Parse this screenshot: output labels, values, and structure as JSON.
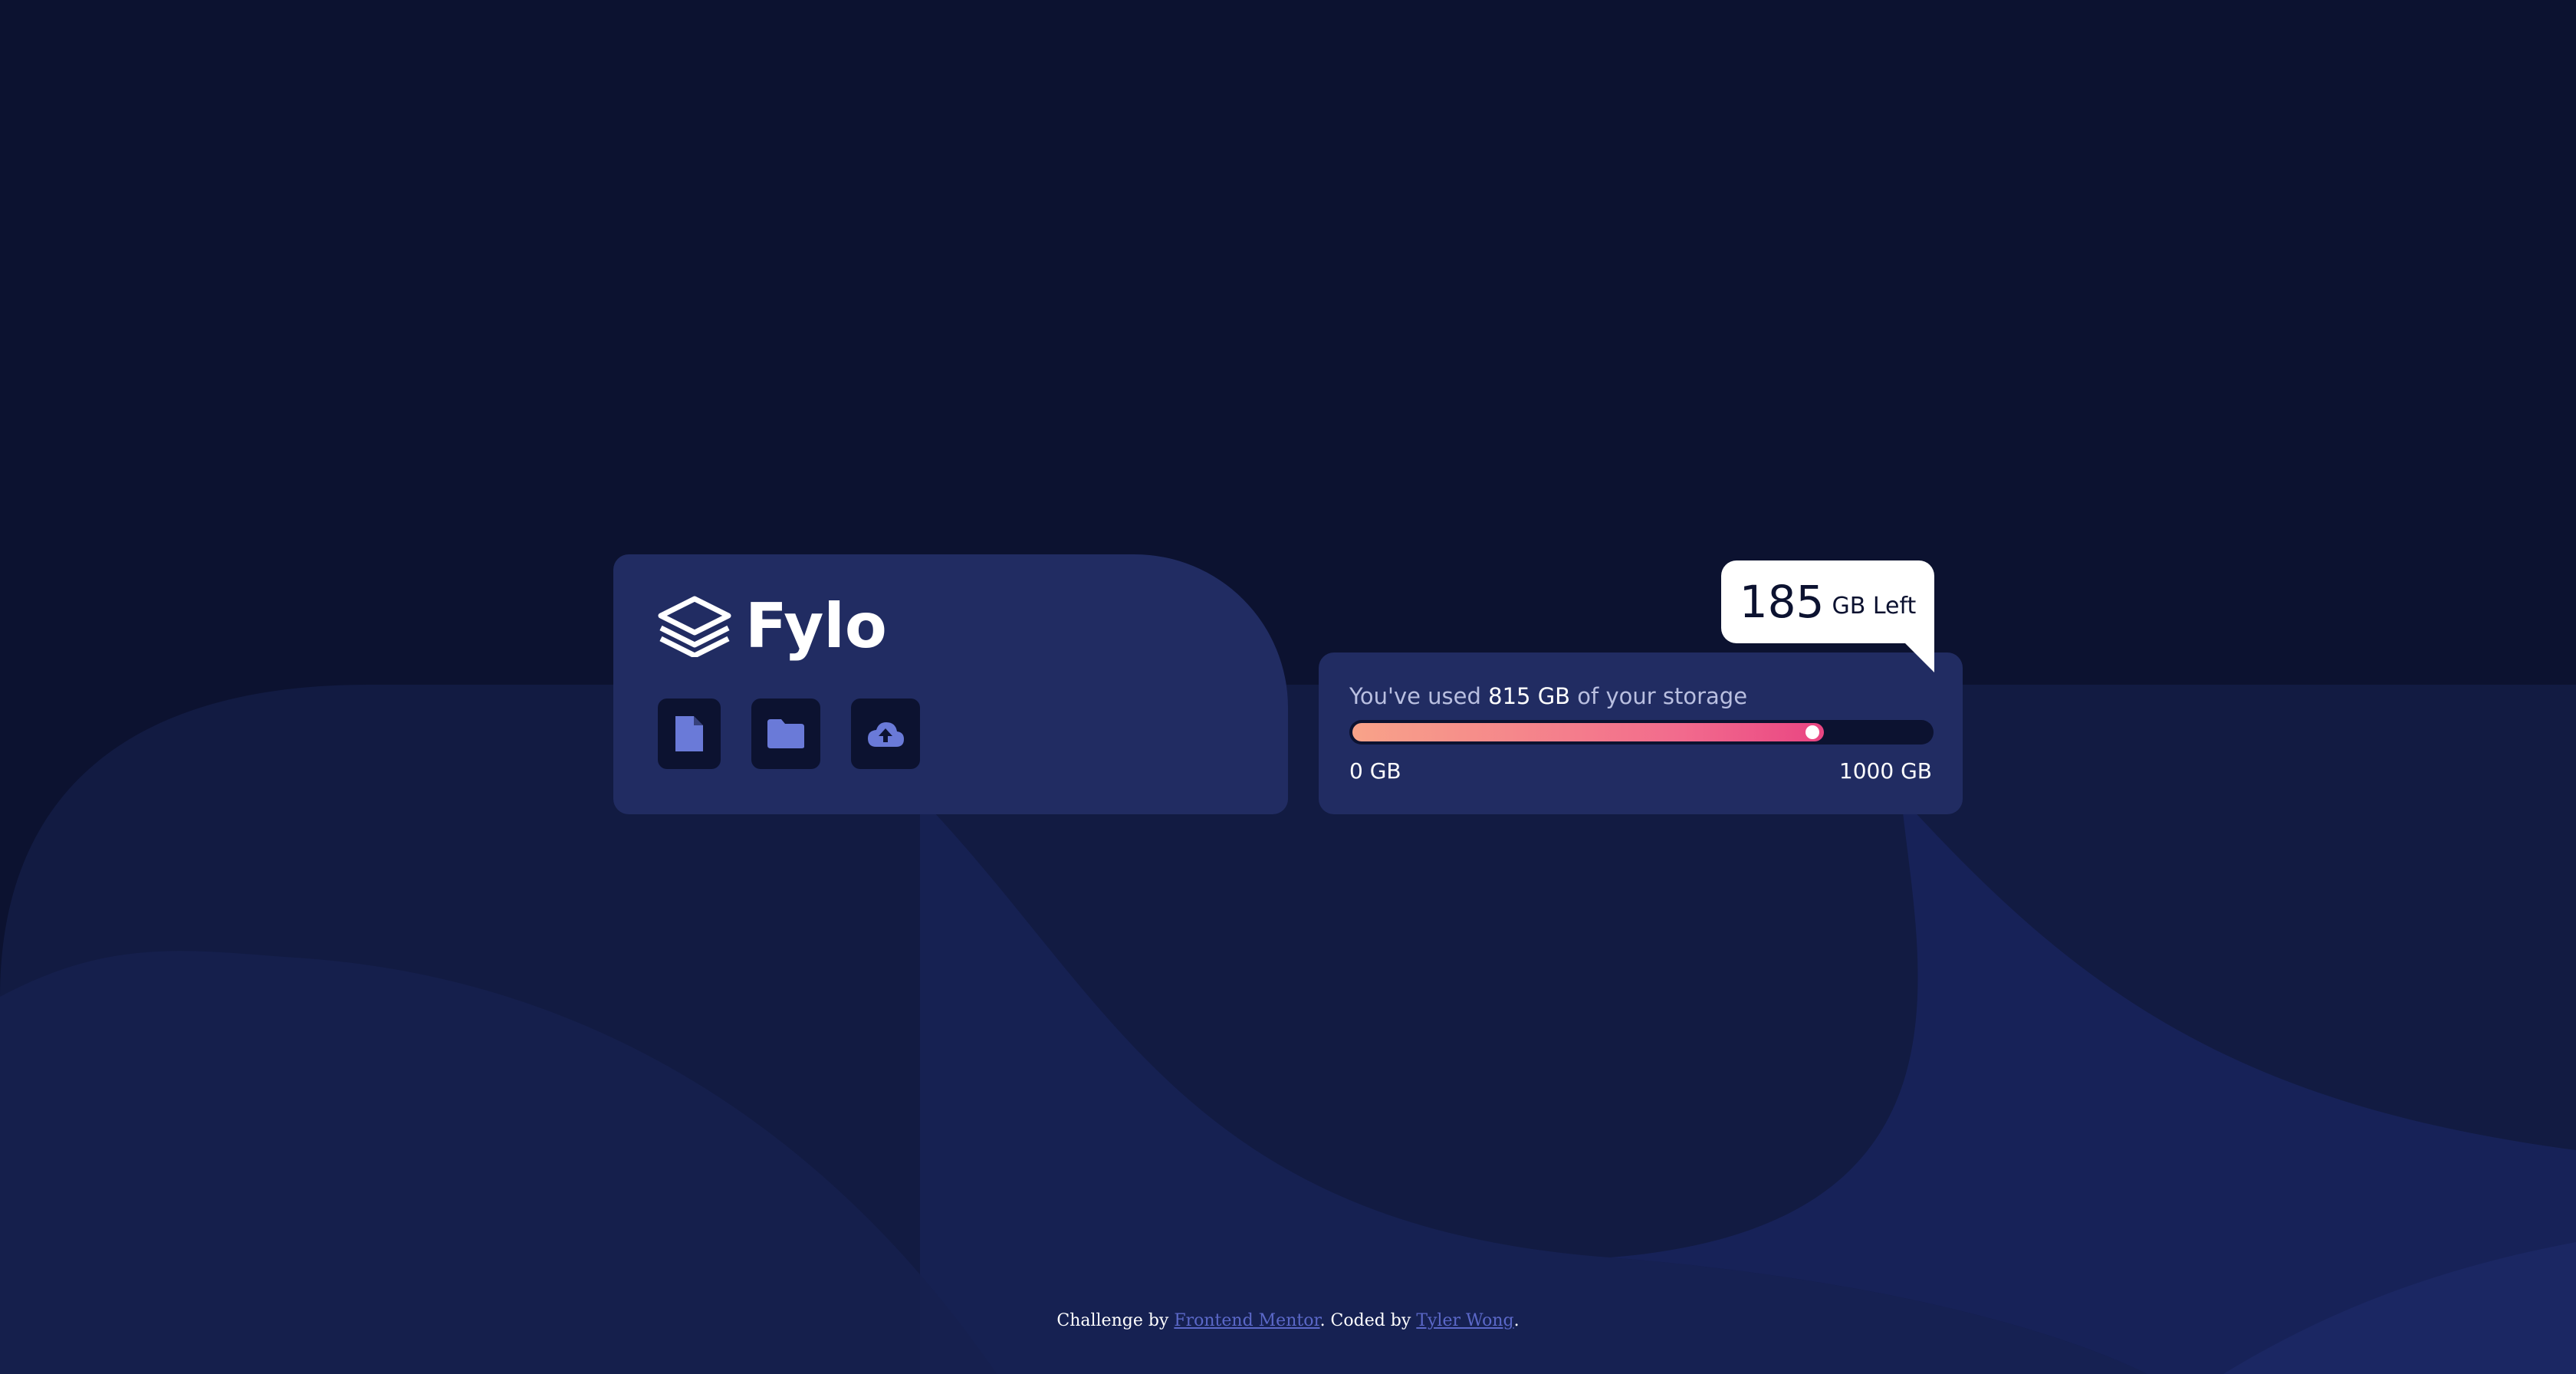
{
  "brand": {
    "name": "Fylo",
    "logo_icon": "layers-icon"
  },
  "actions": [
    {
      "icon": "document-icon"
    },
    {
      "icon": "folder-icon"
    },
    {
      "icon": "cloud-upload-icon"
    }
  ],
  "storage": {
    "used_prefix": "You've used",
    "used_value": "815 GB",
    "used_suffix": "of your storage",
    "used_fraction": 0.815,
    "min_label": "0 GB",
    "max_label": "1000 GB"
  },
  "bubble": {
    "number": "185",
    "unit": "GB Left"
  },
  "footer": {
    "prefix": "Challenge by",
    "link1": "Frontend Mentor",
    "middle": ". Coded by",
    "link2": "Tyler Wong",
    "suffix": "."
  },
  "colors": {
    "page_bg": "#0c1230",
    "card_bg": "#212c62",
    "icon_color": "#6a7ad8",
    "progress_start": "#f8a389",
    "progress_end": "#e94582",
    "link": "#5b68c8"
  }
}
